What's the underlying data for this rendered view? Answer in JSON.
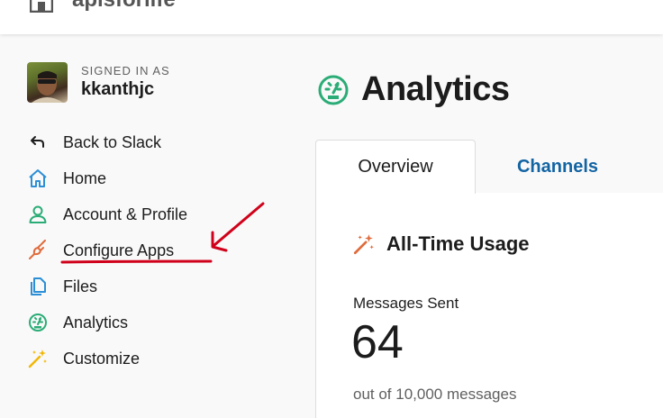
{
  "header": {
    "team_name": "apisforlife"
  },
  "user": {
    "signed_in_label": "SIGNED IN AS",
    "username": "kkanthjc"
  },
  "sidebar": {
    "items": [
      {
        "label": "Back to Slack",
        "icon": "back-arrow-icon"
      },
      {
        "label": "Home",
        "icon": "home-icon"
      },
      {
        "label": "Account & Profile",
        "icon": "user-icon"
      },
      {
        "label": "Configure Apps",
        "icon": "plug-icon"
      },
      {
        "label": "Files",
        "icon": "files-icon"
      },
      {
        "label": "Analytics",
        "icon": "speedometer-icon"
      },
      {
        "label": "Customize",
        "icon": "magic-wand-icon"
      }
    ]
  },
  "main": {
    "title": "Analytics",
    "tabs": [
      {
        "label": "Overview"
      },
      {
        "label": "Channels"
      }
    ],
    "section_title": "All-Time Usage",
    "stat": {
      "label": "Messages Sent",
      "value": "64",
      "sublabel": "out of 10,000 messages"
    }
  },
  "colors": {
    "link_blue": "#1264a3",
    "annotation_red": "#d0021b",
    "analytics_green": "#2bac76"
  }
}
